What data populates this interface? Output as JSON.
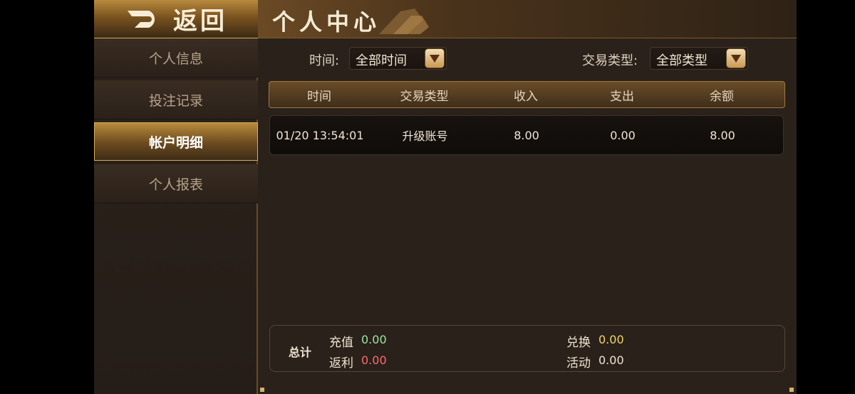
{
  "back_button": {
    "label": "返回",
    "icon": "back-arrow-icon"
  },
  "sidebar": {
    "items": [
      {
        "label": "个人信息",
        "active": false
      },
      {
        "label": "投注记录",
        "active": false
      },
      {
        "label": "帐户明细",
        "active": true
      },
      {
        "label": "个人报表",
        "active": false
      }
    ]
  },
  "header": {
    "title": "个人中心"
  },
  "filters": {
    "time": {
      "label": "时间:",
      "value": "全部时间"
    },
    "type": {
      "label": "交易类型:",
      "value": "全部类型"
    }
  },
  "table": {
    "columns": [
      "时间",
      "交易类型",
      "收入",
      "支出",
      "余额"
    ],
    "rows": [
      {
        "time": "01/20 13:54:01",
        "type": "升级账号",
        "income": "8.00",
        "expense": "0.00",
        "balance": "8.00"
      }
    ]
  },
  "summary": {
    "label": "总计",
    "recharge": {
      "label": "充值",
      "value": "0.00"
    },
    "rebate": {
      "label": "返利",
      "value": "0.00"
    },
    "exchange": {
      "label": "兑换",
      "value": "0.00"
    },
    "activity": {
      "label": "活动",
      "value": "0.00"
    }
  },
  "colors": {
    "gold": "#d7aa55",
    "recharge_green": "#9be7a0",
    "rebate_red": "#ff6b6b",
    "exchange_yellow": "#f2d36b",
    "activity_white": "#f0e4cf"
  }
}
